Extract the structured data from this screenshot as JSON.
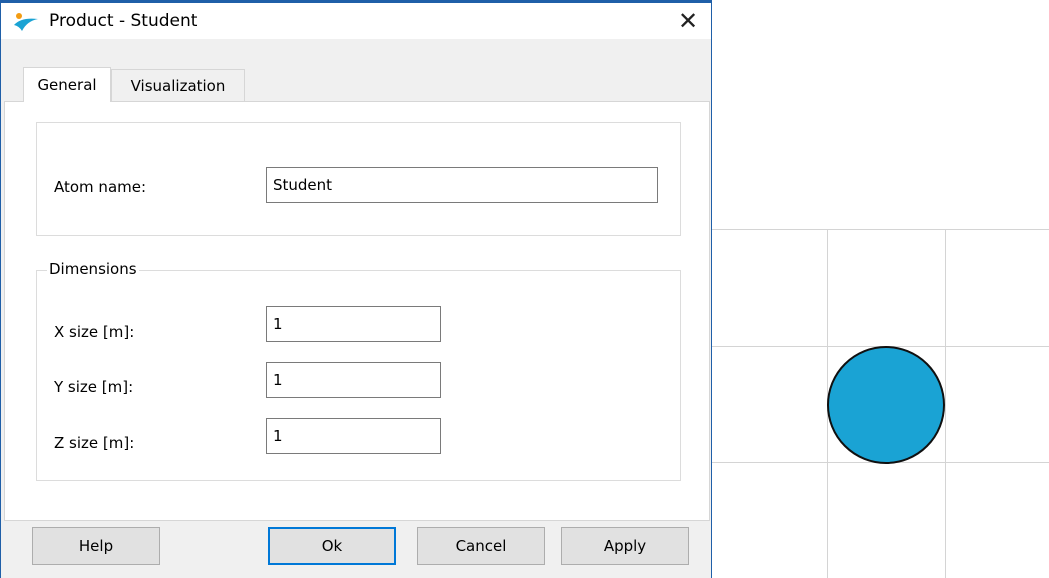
{
  "window": {
    "title": "Product - Student",
    "close_glyph": "✕",
    "icon": "app-logo-icon",
    "accent_color": "#1f5fa8"
  },
  "tabs": [
    {
      "label": "General",
      "active": true
    },
    {
      "label": "Visualization",
      "active": false
    }
  ],
  "general": {
    "atom_name_label": "Atom name:",
    "atom_name_value": "Student",
    "dimensions_legend": "Dimensions",
    "x_label": "X size [m]:",
    "x_value": "1",
    "y_label": "Y size [m]:",
    "y_value": "1",
    "z_label": "Z size [m]:",
    "z_value": "1"
  },
  "buttons": {
    "help": "Help",
    "ok": "Ok",
    "cancel": "Cancel",
    "apply": "Apply"
  },
  "canvas": {
    "grid_color": "#d4d4d4",
    "atom_fill": "#1aa3d4",
    "atom_outline": "#101010"
  }
}
